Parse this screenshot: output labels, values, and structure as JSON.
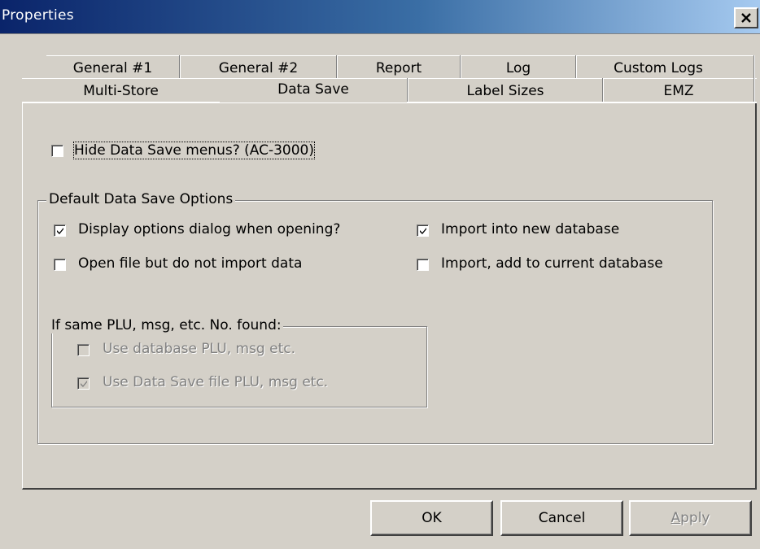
{
  "window": {
    "title": "Properties"
  },
  "tabs": {
    "row1": [
      "General #1",
      "General #2",
      "Report",
      "Log",
      "Custom Logs"
    ],
    "row2": [
      "Multi-Store",
      "Data Save",
      "Label Sizes",
      "EMZ"
    ],
    "active": "Data Save"
  },
  "hide_menus": {
    "label": "Hide Data Save menus? (AC-3000)",
    "checked": false
  },
  "default_options": {
    "title": "Default Data Save Options",
    "display_dialog": {
      "label": "Display options dialog when opening?",
      "checked": true
    },
    "open_no_import": {
      "label": "Open file but do not import data",
      "checked": false
    },
    "import_new": {
      "label": "Import into new database",
      "checked": true
    },
    "import_add": {
      "label": "Import, add to current database",
      "checked": false
    }
  },
  "same_plu": {
    "title": "If same PLU, msg, etc. No. found:",
    "use_database": {
      "label": "Use database PLU, msg etc.",
      "checked": false,
      "disabled": true
    },
    "use_file": {
      "label": "Use Data Save file PLU, msg etc.",
      "checked": true,
      "disabled": true
    }
  },
  "buttons": {
    "ok": "OK",
    "cancel": "Cancel",
    "apply": "Apply"
  },
  "icons": {
    "close": "close-icon",
    "check": "checkmark-icon"
  }
}
